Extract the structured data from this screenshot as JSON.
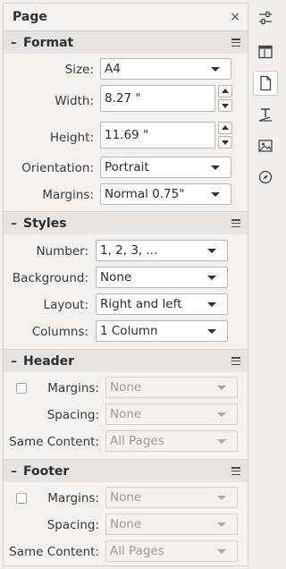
{
  "panel": {
    "title": "Page",
    "close_glyph": "×"
  },
  "format": {
    "title": "Format",
    "size_label": "Size:",
    "size_value": "A4",
    "width_label": "Width:",
    "width_value": "8.27 \"",
    "height_label": "Height:",
    "height_value": "11.69 \"",
    "orientation_label": "Orientation:",
    "orientation_value": "Portrait",
    "margins_label": "Margins:",
    "margins_value": "Normal 0.75\""
  },
  "styles": {
    "title": "Styles",
    "number_label": "Number:",
    "number_value": "1, 2, 3, ...",
    "background_label": "Background:",
    "background_value": "None",
    "layout_label": "Layout:",
    "layout_value": "Right and left",
    "columns_label": "Columns:",
    "columns_value": "1 Column"
  },
  "header": {
    "title": "Header",
    "margins_label": "Margins:",
    "margins_value": "None",
    "spacing_label": "Spacing:",
    "spacing_value": "None",
    "same_content_label": "Same Content:",
    "same_content_value": "All Pages"
  },
  "footer": {
    "title": "Footer",
    "margins_label": "Margins:",
    "margins_value": "None",
    "spacing_label": "Spacing:",
    "spacing_value": "None",
    "same_content_label": "Same Content:",
    "same_content_value": "All Pages"
  },
  "sidebar_tabs": [
    {
      "icon": "properties-sliders-icon",
      "active": false
    },
    {
      "icon": "styles-icon",
      "active": false
    },
    {
      "icon": "page-icon",
      "active": true
    },
    {
      "icon": "gallery-text-style-icon",
      "active": false
    },
    {
      "icon": "image-icon",
      "active": false
    },
    {
      "icon": "navigator-compass-icon",
      "active": false
    }
  ],
  "colors": {
    "panel_bg": "#f2f1f0",
    "section_bg": "#e6e4e2",
    "disabled_text": "#9d9b98"
  }
}
